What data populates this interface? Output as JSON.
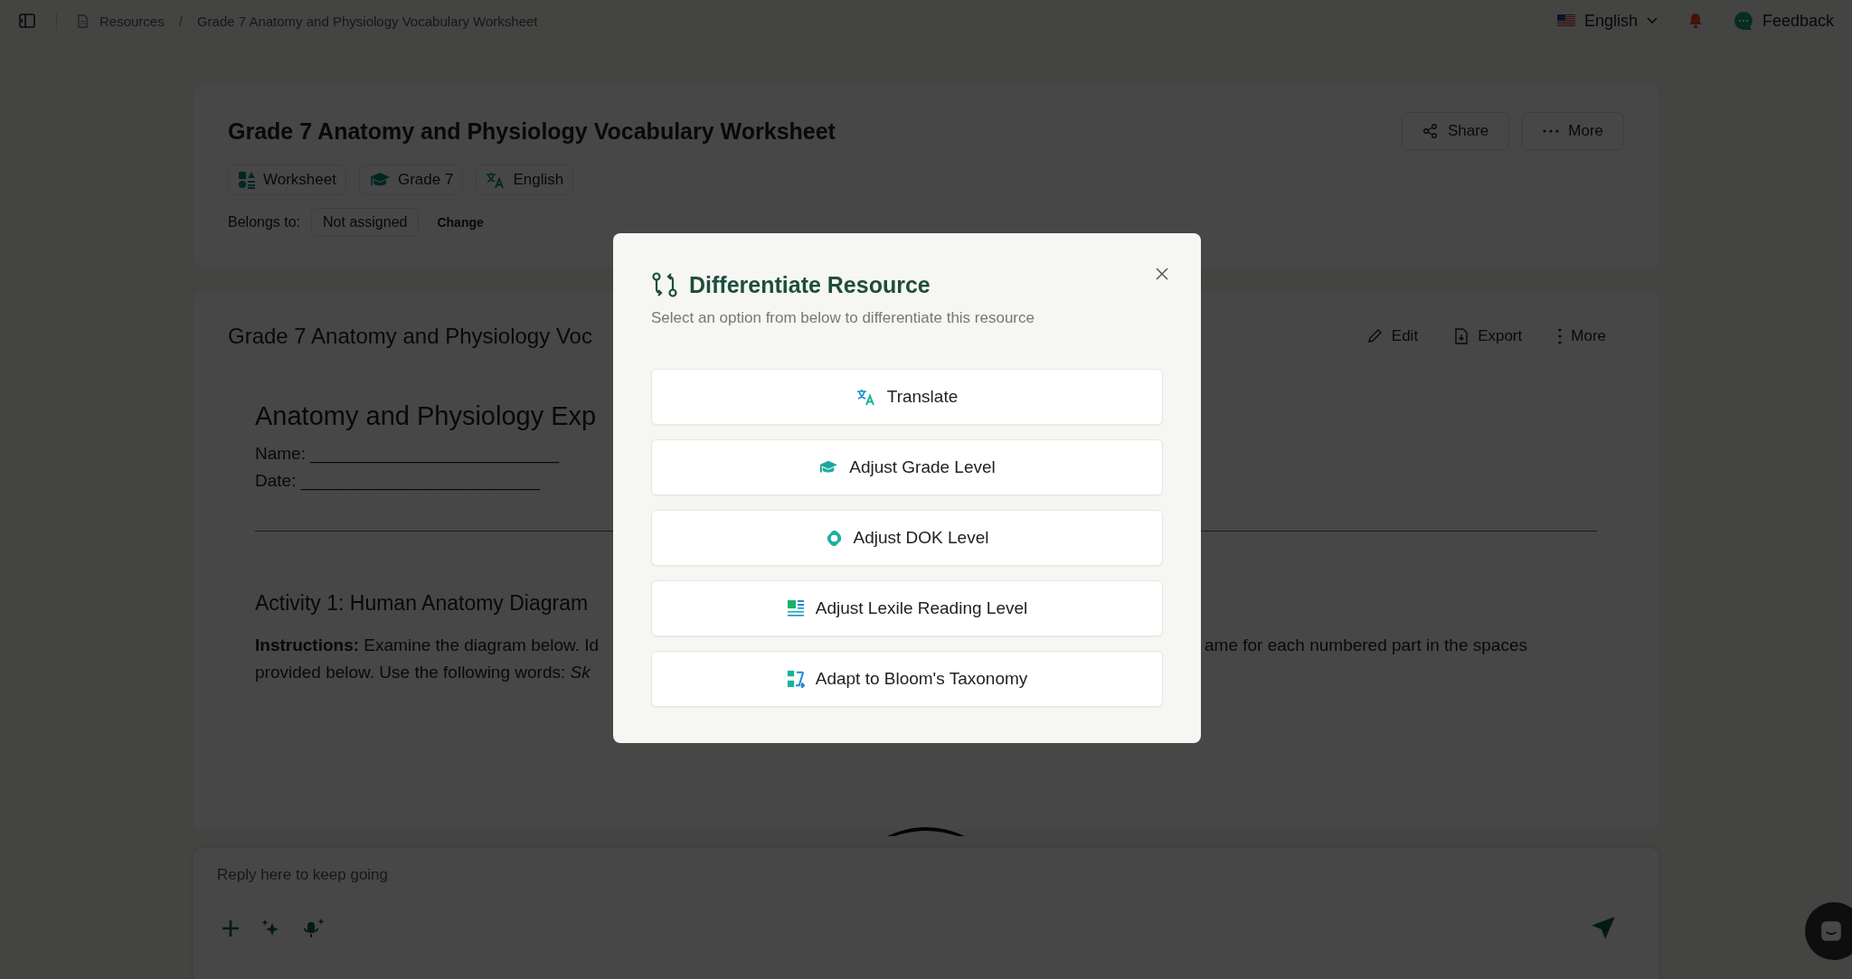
{
  "topbar": {
    "breadcrumb": [
      "Resources",
      "Grade 7 Anatomy and Physiology Vocabulary Worksheet"
    ],
    "breadcrumb_separator": "/",
    "language": "English",
    "feedback": "Feedback"
  },
  "header": {
    "title": "Grade 7 Anatomy and Physiology Vocabulary Worksheet",
    "actions": [
      {
        "kind": "share",
        "label": "Share"
      },
      {
        "kind": "more",
        "label": "More"
      }
    ],
    "tags": [
      {
        "kind": "type",
        "label": "Worksheet"
      },
      {
        "kind": "grade",
        "label": "Grade 7"
      },
      {
        "kind": "language",
        "label": "English"
      }
    ],
    "belongs_label": "Belongs to:",
    "belongs_value": "Not assigned",
    "change": "Change"
  },
  "document": {
    "title": "Grade 7 Anatomy and Physiology Voc",
    "actions": [
      {
        "kind": "edit",
        "label": "Edit"
      },
      {
        "kind": "export",
        "label": "Export"
      },
      {
        "kind": "more",
        "label": "More"
      }
    ],
    "heading": "Anatomy and Physiology Exp",
    "fields": [
      "Name: __________________________",
      "Date: _________________________"
    ],
    "activity": "Activity 1: Human Anatomy Diagram",
    "lines": [
      {
        "left": "**Instructions:** Examine the diagram below. Id",
        "right": "ame for each numbered part in the spaces"
      },
      {
        "left": "provided below. Use the following words: *Sk*"
      }
    ]
  },
  "modal": {
    "title": "Differentiate Resource",
    "subtitle": "Select an option from below to differentiate this resource",
    "options": [
      {
        "kind": "translate",
        "label": "Translate"
      },
      {
        "kind": "grade",
        "label": "Adjust Grade Level"
      },
      {
        "kind": "dok",
        "label": "Adjust DOK Level"
      },
      {
        "kind": "lexile",
        "label": "Adjust Lexile Reading Level"
      },
      {
        "kind": "bloom",
        "label": "Adapt to Bloom's Taxonomy"
      }
    ]
  },
  "reply": {
    "placeholder": "Reply here to keep going"
  }
}
